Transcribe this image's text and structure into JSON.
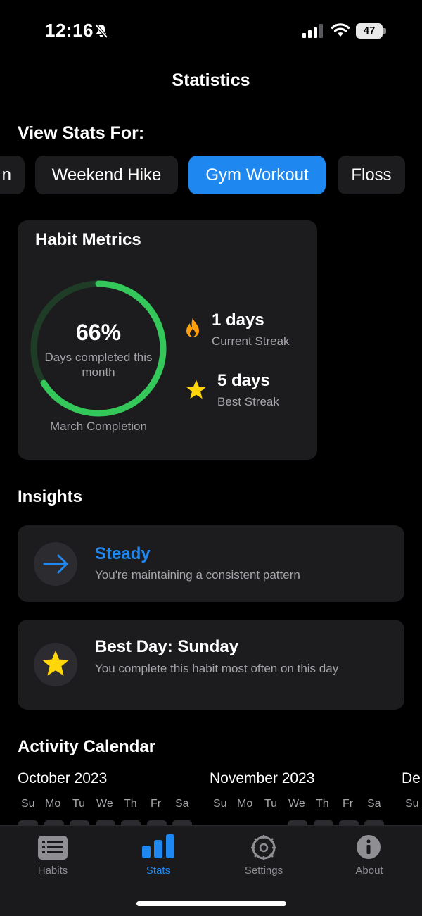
{
  "status_bar": {
    "time": "12:16",
    "battery": "47"
  },
  "nav": {
    "title": "Statistics"
  },
  "filter": {
    "label": "View Stats For:",
    "chips": [
      "n",
      "Weekend Hike",
      "Gym Workout",
      "Floss"
    ],
    "selected": "Gym Workout"
  },
  "metrics": {
    "title": "Habit Metrics",
    "completion_percent": "66%",
    "completion_fraction": 0.66,
    "completion_sub": "Days completed this month",
    "completion_caption": "March Completion",
    "current_streak_value": "1 days",
    "current_streak_label": "Current Streak",
    "best_streak_value": "5 days",
    "best_streak_label": "Best Streak"
  },
  "insights": {
    "title": "Insights",
    "items": [
      {
        "title": "Steady",
        "description": "You're maintaining a consistent pattern",
        "icon": "arrow-right-icon"
      },
      {
        "title": "Best Day: Sunday",
        "description": "You complete this habit most often on this day",
        "icon": "star-icon"
      }
    ]
  },
  "calendar": {
    "title": "Activity Calendar",
    "months": [
      "October 2023",
      "November 2023",
      "De"
    ],
    "weekdays": [
      "Su",
      "Mo",
      "Tu",
      "We",
      "Th",
      "Fr",
      "Sa"
    ]
  },
  "tabs": [
    {
      "label": "Habits",
      "icon": "list-icon"
    },
    {
      "label": "Stats",
      "icon": "bar-chart-icon"
    },
    {
      "label": "Settings",
      "icon": "gear-icon"
    },
    {
      "label": "About",
      "icon": "info-icon"
    }
  ],
  "active_tab": "Stats",
  "colors": {
    "accent": "#1e88f0",
    "ring": "#34c759",
    "streak_fire": "#ff9f0a",
    "star": "#ffd60a"
  }
}
